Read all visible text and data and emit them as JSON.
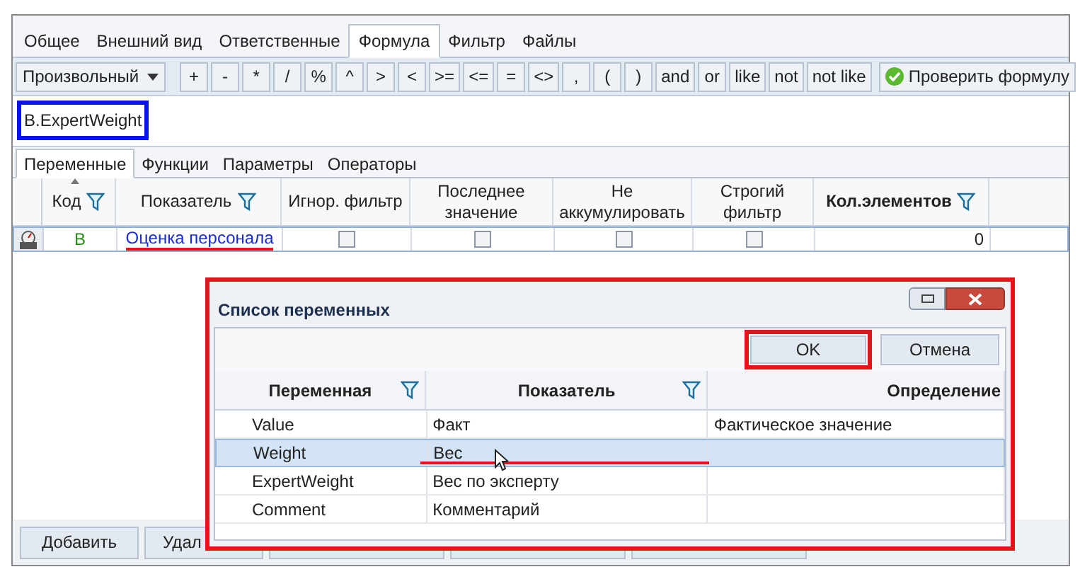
{
  "tabs": [
    {
      "label": "Общее",
      "selected": false
    },
    {
      "label": "Внешний вид",
      "selected": false
    },
    {
      "label": "Ответственные",
      "selected": false
    },
    {
      "label": "Формула",
      "selected": true
    },
    {
      "label": "Фильтр",
      "selected": false
    },
    {
      "label": "Файлы",
      "selected": false
    }
  ],
  "toolbar": {
    "mode": "Произвольный",
    "operators": [
      "+",
      "-",
      "*",
      "/",
      "%",
      "^",
      ">",
      "<",
      ">=",
      "<=",
      "=",
      "<>",
      ",",
      "(",
      ")",
      "and",
      "or",
      "like",
      "not",
      "not like"
    ],
    "check_button": "Проверить формулу"
  },
  "formula": "B.ExpertWeight",
  "subtabs": [
    {
      "label": "Переменные",
      "selected": true
    },
    {
      "label": "Функции",
      "selected": false
    },
    {
      "label": "Параметры",
      "selected": false
    },
    {
      "label": "Операторы",
      "selected": false
    }
  ],
  "grid": {
    "columns": [
      {
        "label": "Код",
        "filter": true,
        "sort": true
      },
      {
        "label": "Показатель",
        "filter": true,
        "sort": false
      },
      {
        "label": "Игнор. фильтр",
        "filter": false,
        "sort": false
      },
      {
        "label": "Последнее значение",
        "filter": false,
        "sort": false
      },
      {
        "label": "Не аккумулировать",
        "filter": false,
        "sort": false
      },
      {
        "label": "Строгий фильтр",
        "filter": false,
        "sort": false
      },
      {
        "label": "Кол.элементов",
        "filter": true,
        "sort": false,
        "bold": true
      }
    ],
    "rows": [
      {
        "code": "B",
        "indicator": "Оценка персонала",
        "flags": [
          false,
          false,
          false,
          false
        ],
        "count": "0"
      }
    ]
  },
  "bottom_buttons": [
    "Добавить",
    "Удал"
  ],
  "dialog": {
    "title": "Список переменных",
    "ok": "OK",
    "cancel": "Отмена",
    "columns": [
      {
        "label": "Переменная",
        "filter": true
      },
      {
        "label": "Показатель",
        "filter": true
      },
      {
        "label": "Определение",
        "filter": false
      }
    ],
    "rows": [
      {
        "cells": [
          "Value",
          "Факт",
          "Фактическое значение"
        ],
        "selected": false
      },
      {
        "cells": [
          "Weight",
          "Вес",
          ""
        ],
        "selected": true
      },
      {
        "cells": [
          "ExpertWeight",
          "Вес по эксперту",
          ""
        ],
        "selected": false
      },
      {
        "cells": [
          "Comment",
          "Комментарий",
          ""
        ],
        "selected": false
      }
    ]
  }
}
